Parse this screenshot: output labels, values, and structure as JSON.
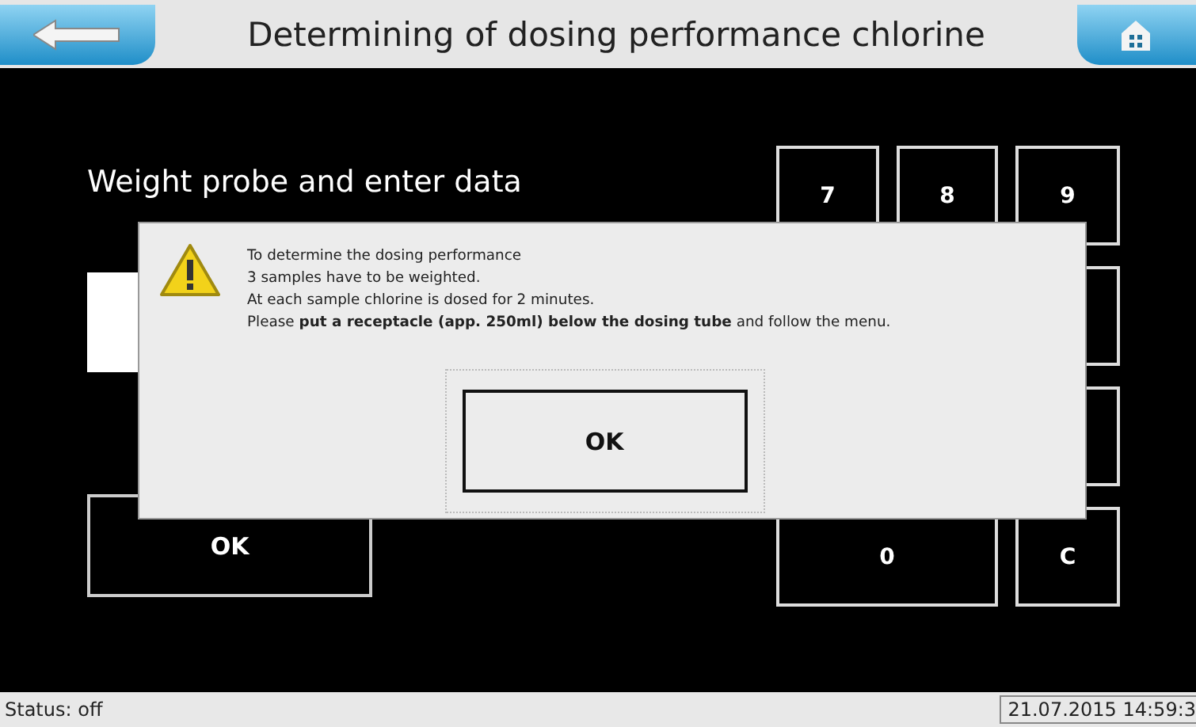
{
  "header": {
    "title": "Determining of dosing performance chlorine"
  },
  "prompt": "Weight probe and enter data",
  "ok_button": "OK",
  "keypad": [
    {
      "label": "7",
      "kind": "key"
    },
    {
      "label": "8",
      "kind": "key"
    },
    {
      "label": "9",
      "kind": "key"
    },
    {
      "kind": "hidden"
    },
    {
      "kind": "hidden"
    },
    {
      "label": "0",
      "kind": "wide"
    },
    {
      "label": "C",
      "kind": "key"
    }
  ],
  "dialog": {
    "lines": [
      "To determine the dosing performance",
      "3 samples have to be weighted.",
      "At each sample chlorine is dosed for 2 minutes.",
      "Please **put a receptacle (app. 250ml) below the dosing tube** and follow the menu."
    ],
    "button": "OK"
  },
  "status_bar": {
    "status": "Status: off",
    "timestamp": "21.07.2015 14:59:3"
  }
}
